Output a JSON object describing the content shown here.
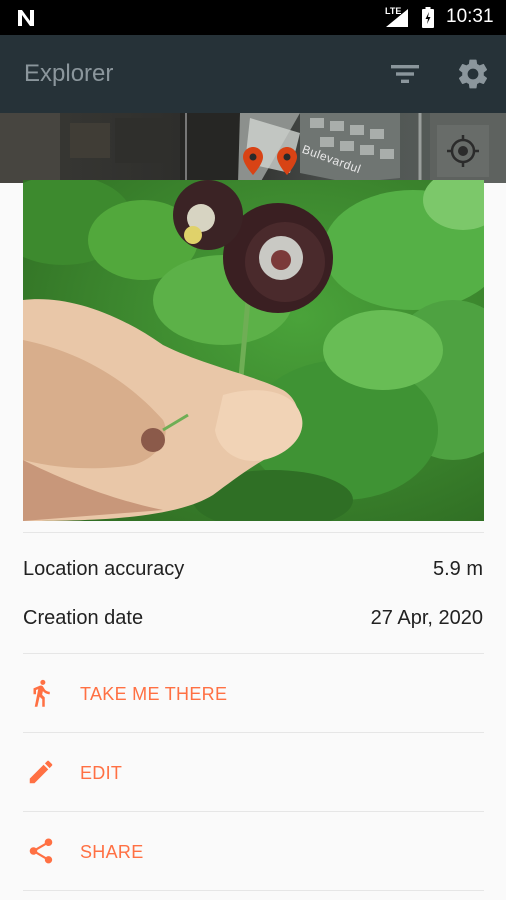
{
  "status_bar": {
    "network": "LTE",
    "time": "10:31"
  },
  "app_bar": {
    "title": "Explorer"
  },
  "map": {
    "road_label": "Bulevardul"
  },
  "details": {
    "location_accuracy_label": "Location accuracy",
    "location_accuracy_value": "5.9 m",
    "creation_date_label": "Creation date",
    "creation_date_value": "27 Apr, 2020"
  },
  "actions": {
    "take_me_there": "TAKE ME THERE",
    "edit": "EDIT",
    "share": "SHARE"
  },
  "colors": {
    "accent": "#ff7043",
    "app_bar": "#263238",
    "title": "#8b969c"
  },
  "icons": {
    "notification": "n-notification-icon",
    "signal": "signal-icon",
    "battery": "battery-icon",
    "filter": "filter-icon",
    "settings": "gear-icon",
    "locate": "my-location-icon",
    "pin": "map-pin-icon",
    "walk": "walk-icon",
    "edit": "pencil-icon",
    "share": "share-icon"
  }
}
